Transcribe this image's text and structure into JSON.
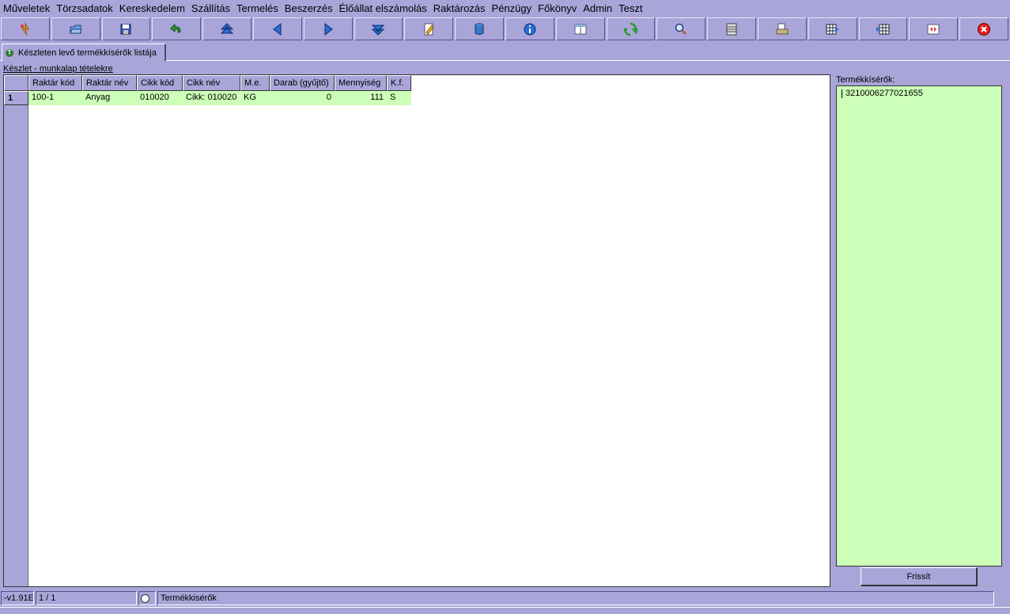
{
  "menubar": {
    "items": [
      "Műveletek",
      "Törzsadatok",
      "Kereskedelem",
      "Szállítás",
      "Termelés",
      "Beszerzés",
      "Élőállat elszámolás",
      "Raktározás",
      "Pénzügy",
      "Főkönyv",
      "Admin",
      "Teszt"
    ]
  },
  "toolbar": {
    "buttons": [
      {
        "name": "new-record-icon"
      },
      {
        "name": "open-folder-icon"
      },
      {
        "name": "save-icon"
      },
      {
        "name": "undo-icon"
      },
      {
        "name": "first-record-icon"
      },
      {
        "name": "previous-record-icon"
      },
      {
        "name": "next-record-icon"
      },
      {
        "name": "last-record-icon"
      },
      {
        "name": "edit-icon"
      },
      {
        "name": "database-icon"
      },
      {
        "name": "info-icon"
      },
      {
        "name": "window-icon"
      },
      {
        "name": "refresh-icon"
      },
      {
        "name": "search-icon"
      },
      {
        "name": "filter-icon"
      },
      {
        "name": "print-icon"
      },
      {
        "name": "export-table-icon"
      },
      {
        "name": "import-table-icon"
      },
      {
        "name": "layout-icon"
      },
      {
        "name": "close-icon"
      }
    ]
  },
  "tab": {
    "label": "Készleten levő termékkísérők listája"
  },
  "section_label": "Készlet - munkalap tételekre",
  "grid": {
    "columns": [
      "Raktár kód",
      "Raktár név",
      "Cikk kód",
      "Cikk név",
      "M.e.",
      "Darab (gyűjtő)",
      "Mennyiség",
      "K.f."
    ],
    "rows": [
      {
        "num": "1",
        "cells": [
          "100-1",
          "Anyag",
          "010020",
          "Cikk: 010020",
          "KG",
          "0",
          "111",
          "S"
        ]
      }
    ]
  },
  "right_panel": {
    "label": "Termékkísérők:",
    "items": [
      "3210006277021655"
    ],
    "refresh_label": "Frissít"
  },
  "statusbar": {
    "version": "-v1.91E",
    "page": "1 / 1",
    "status_text": "Termékkisérők"
  },
  "colors": {
    "background": "#a9a5d9",
    "highlight": "#ccffb8"
  }
}
